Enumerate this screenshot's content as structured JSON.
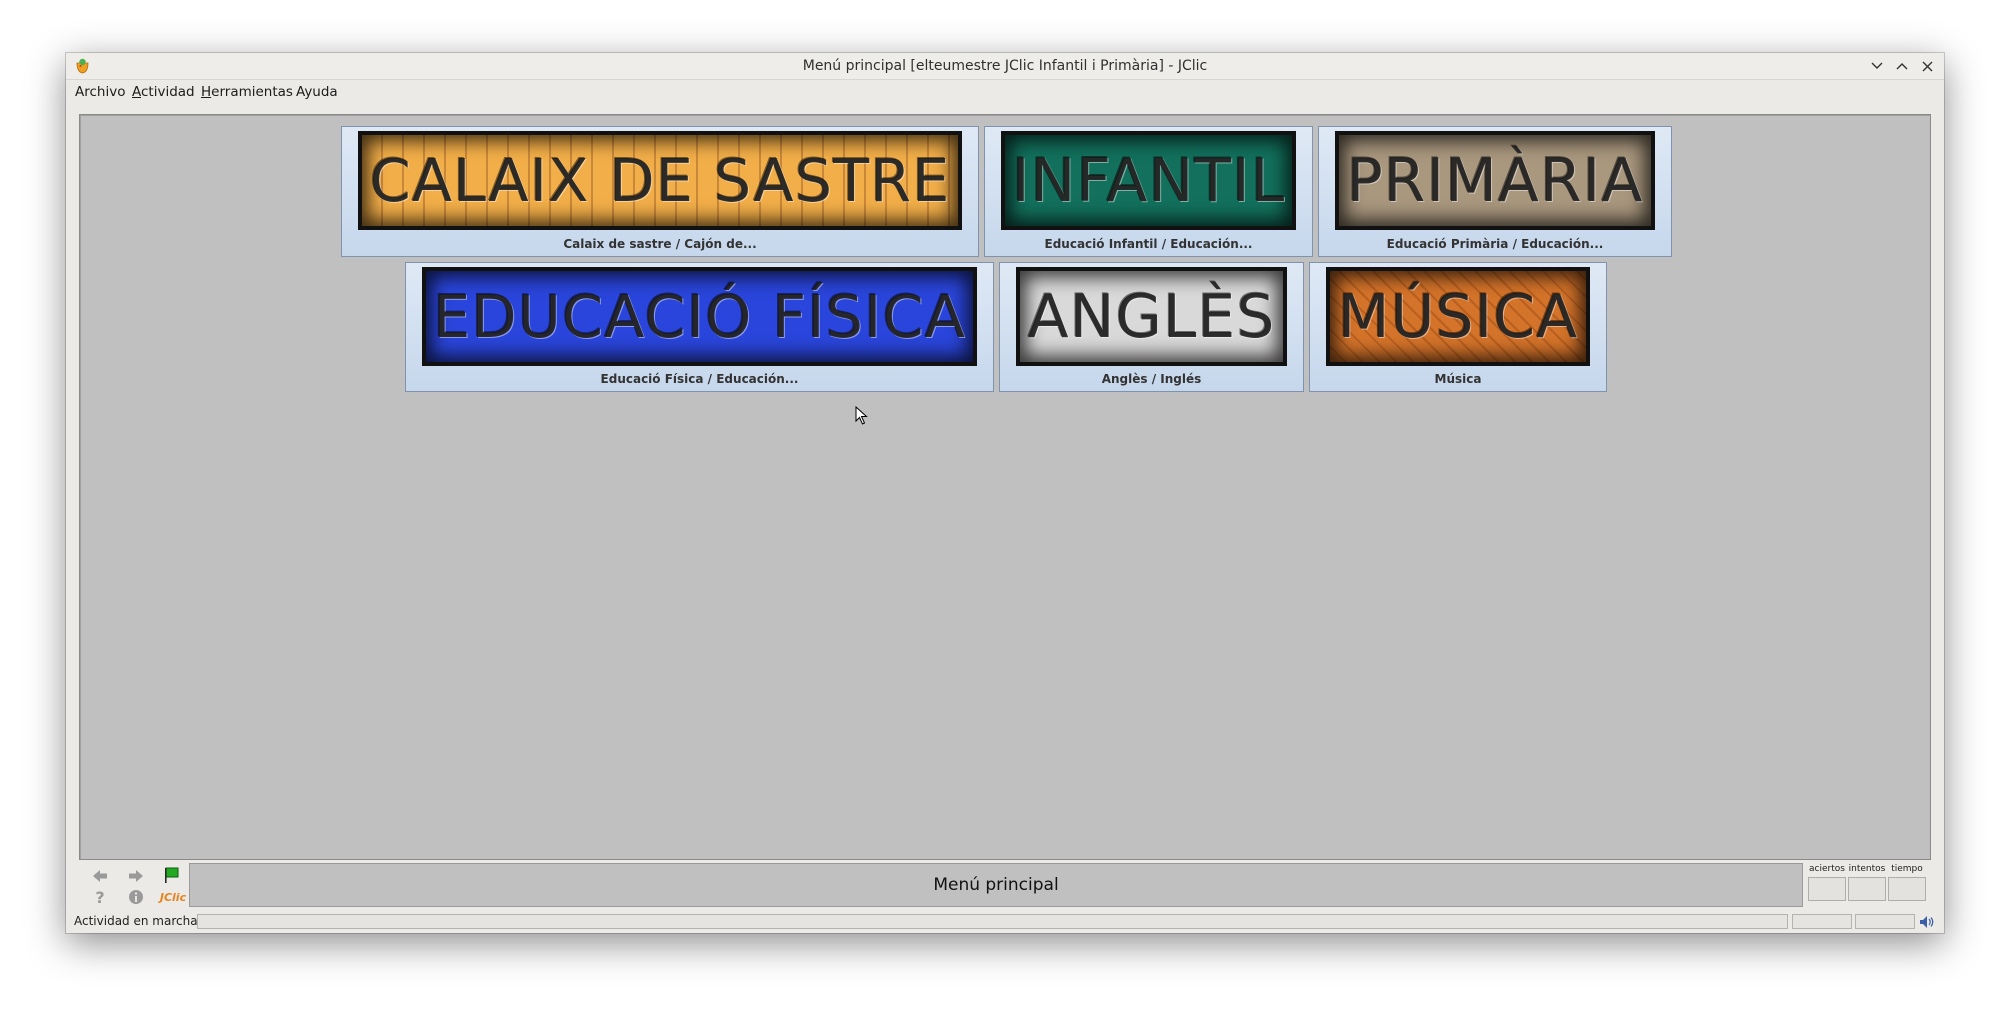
{
  "window": {
    "title": "Menú principal [elteumestre JClic Infantil i Primària] - JClic"
  },
  "menu": {
    "items": [
      {
        "label": "Archivo"
      },
      {
        "mnemonic": "A",
        "rest": "ctividad"
      },
      {
        "mnemonic": "H",
        "rest": "erramientas"
      },
      {
        "label": "Ayuda"
      }
    ]
  },
  "tiles": [
    {
      "word": "CALAIX DE SASTRE",
      "caption": "Calaix de sastre / Cajón de...",
      "color": "#f2ae48"
    },
    {
      "word": "INFANTIL",
      "caption": "Educació Infantil / Educación...",
      "color": "#12705c"
    },
    {
      "word": "PRIMÀRIA",
      "caption": "Educació Primària / Educación...",
      "color": "#a9977e"
    },
    {
      "word": "EDUCACIÓ FÍSICA",
      "caption": "Educació Física / Educación...",
      "color": "#2a45db"
    },
    {
      "word": "ANGLÈS",
      "caption": "Anglès / Inglés",
      "color": "#d9d9d9"
    },
    {
      "word": "MÚSICA",
      "caption": "Música",
      "color": "#d4732a"
    }
  ],
  "controls": {
    "jclic_label": "JClic",
    "message": "Menú principal",
    "counters": [
      "aciertos",
      "intentos",
      "tiempo"
    ]
  },
  "status": {
    "text": "Actividad en marcha"
  },
  "colors": {
    "stage": "#c0c0c0",
    "tile_bg": "#d3e1f1",
    "flag_green": "#22aa22",
    "jclic_orange": "#e8831f"
  }
}
